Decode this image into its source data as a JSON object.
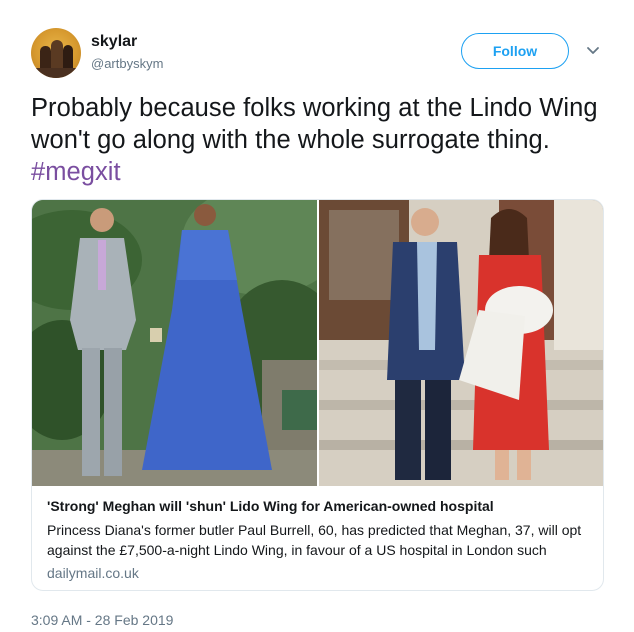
{
  "user": {
    "name": "skylar",
    "handle": "@artbyskym"
  },
  "follow_label": "Follow",
  "tweet": {
    "text": "Probably because folks working at the Lindo Wing won't go along with the whole surrogate thing.",
    "hashtag": "#megxit"
  },
  "card": {
    "title": "'Strong' Meghan will 'shun' Lido Wing for American-owned hospital",
    "description": "Princess Diana's former butler Paul Burrell, 60, has predicted that Meghan, 37, will opt against the £7,500-a-night Lindo Wing, in favour of a US hospital in London such",
    "domain": "dailymail.co.uk"
  },
  "timestamp": "3:09 AM - 28 Feb 2019",
  "colors": {
    "accent": "#1da1f2",
    "hashtag": "#7a4ea0",
    "secondary_text": "#657786",
    "border": "#e1e8ed"
  },
  "icons": {
    "avatar": "avatar-image",
    "menu": "chevron-down-icon"
  }
}
